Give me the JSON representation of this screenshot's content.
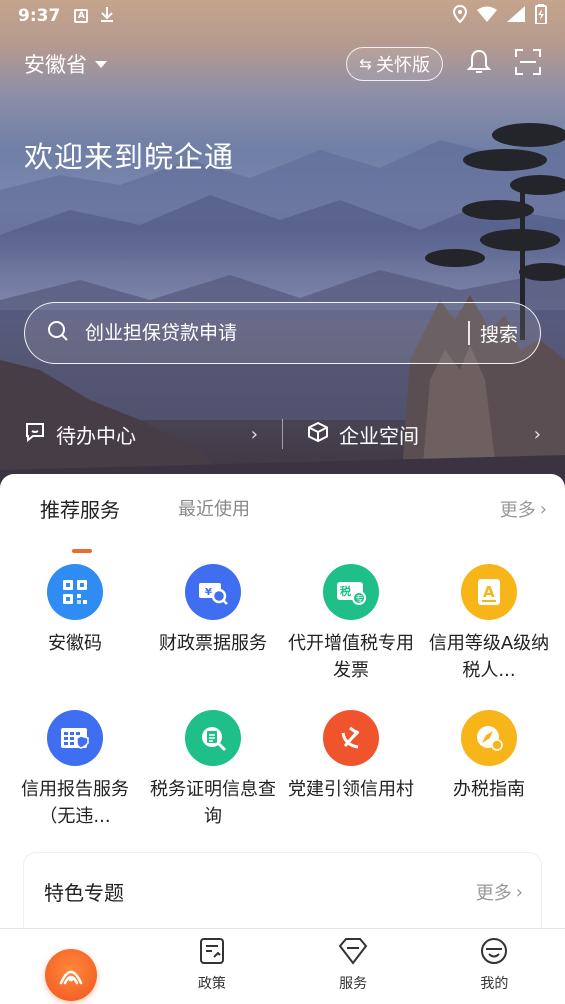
{
  "status_bar": {
    "time": "9:37",
    "badge_a": "A"
  },
  "top_nav": {
    "province": "安徽省",
    "care_mode": "关怀版"
  },
  "hero": {
    "welcome": "欢迎来到皖企通"
  },
  "search": {
    "placeholder": "创业担保贷款申请",
    "button": "搜索"
  },
  "quick": {
    "todo": "待办中心",
    "enterprise": "企业空间"
  },
  "tabs": {
    "recommended": "推荐服务",
    "recent": "最近使用",
    "more": "更多"
  },
  "services": [
    {
      "label": "安徽码",
      "icon": "qr-code-icon",
      "color": "#2f8cf2"
    },
    {
      "label": "财政票据服务",
      "icon": "finance-ticket-icon",
      "color": "#3f6ff0"
    },
    {
      "label": "代开增值税专用发票",
      "icon": "tax-ticket-icon",
      "color": "#1fbf8a"
    },
    {
      "label": "信用等级A级纳税人...",
      "icon": "credit-a-icon",
      "color": "#f7b51a"
    },
    {
      "label": "信用报告服务（无违...",
      "icon": "credit-report-icon",
      "color": "#3f6ff0"
    },
    {
      "label": "税务证明信息查询",
      "icon": "tax-certificate-search-icon",
      "color": "#1fbf8a"
    },
    {
      "label": "党建引领信用村",
      "icon": "party-emblem-icon",
      "color": "#f0542c"
    },
    {
      "label": "办税指南",
      "icon": "tax-guide-compass-icon",
      "color": "#f7b51a"
    }
  ],
  "featured": {
    "title": "特色专题",
    "more": "更多"
  },
  "bottom_nav": {
    "policy": "政策",
    "service": "服务",
    "mine": "我的"
  }
}
